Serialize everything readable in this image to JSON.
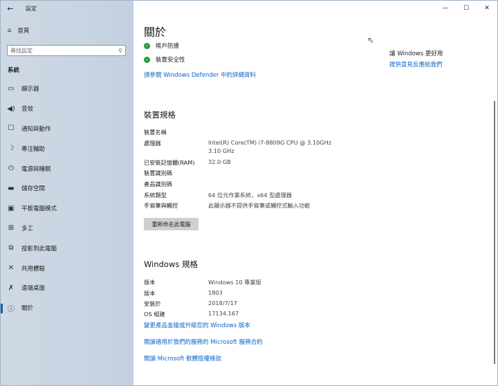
{
  "window": {
    "title": "設定",
    "back_icon": "←",
    "controls": {
      "minimize": "—",
      "maximize": "☐",
      "close": "✕"
    }
  },
  "sidebar": {
    "home": {
      "icon": "⌂",
      "label": "首頁"
    },
    "search": {
      "placeholder": "尋找設定",
      "icon": "⚲"
    },
    "section_label": "系統",
    "items": [
      {
        "icon": "▭",
        "label": "顯示器"
      },
      {
        "icon": "◀)",
        "label": "音效"
      },
      {
        "icon": "☐",
        "label": "通知與動作"
      },
      {
        "icon": "☽",
        "label": "專注輔助"
      },
      {
        "icon": "⏻",
        "label": "電源與睡眠"
      },
      {
        "icon": "▬",
        "label": "儲存空間"
      },
      {
        "icon": "▣",
        "label": "平板電腦模式"
      },
      {
        "icon": "⊞",
        "label": "多工"
      },
      {
        "icon": "⧉",
        "label": "投影到此電腦"
      },
      {
        "icon": "✕",
        "label": "共用體驗"
      },
      {
        "icon": "✗",
        "label": "遠端桌面"
      },
      {
        "icon": "ⓘ",
        "label": "關於",
        "active": true
      }
    ]
  },
  "main": {
    "heading": "關於",
    "status": [
      {
        "icon": "✓",
        "label": "帳戶防護"
      },
      {
        "icon": "✓",
        "label": "裝置安全性"
      }
    ],
    "defender_link": "請參閱 Windows Defender 中的詳細資料",
    "device_specs": {
      "heading": "裝置規格",
      "rows": [
        {
          "label": "裝置名稱",
          "value": ""
        },
        {
          "label": "處理器",
          "value": "Intel(R) Core(TM) i7-8809G CPU @ 3.10GHz",
          "value2": "3.10 GHz"
        },
        {
          "label": "已安裝記憶體(RAM)",
          "value": "32.0 GB"
        },
        {
          "label": "裝置識別碼",
          "value": ""
        },
        {
          "label": "產品識別碼",
          "value": ""
        },
        {
          "label": "系統類型",
          "value": "64 位元作業系統，x64 型處理器"
        },
        {
          "label": "手寫筆與觸控",
          "value": "此顯示器不提供手寫筆或觸控式輸入功能"
        }
      ],
      "rename_button": "重新命名此電腦"
    },
    "windows_specs": {
      "heading": "Windows 規格",
      "rows": [
        {
          "label": "版本",
          "value": "Windows 10 專業版"
        },
        {
          "label": "版本",
          "value": "1803"
        },
        {
          "label": "安裝於",
          "value": "2018/7/17"
        },
        {
          "label": "OS 組建",
          "value": "17134.167"
        }
      ],
      "links": [
        "變更產品金鑰或升級您的 Windows 版本",
        "閱讀適用於我們的服務的 Microsoft 服務合約",
        "閱讀 Microsoft 軟體授權條款"
      ]
    },
    "right_panel": {
      "heading": "讓 Windows 更好用",
      "link": "提供意見反應給我們"
    }
  }
}
